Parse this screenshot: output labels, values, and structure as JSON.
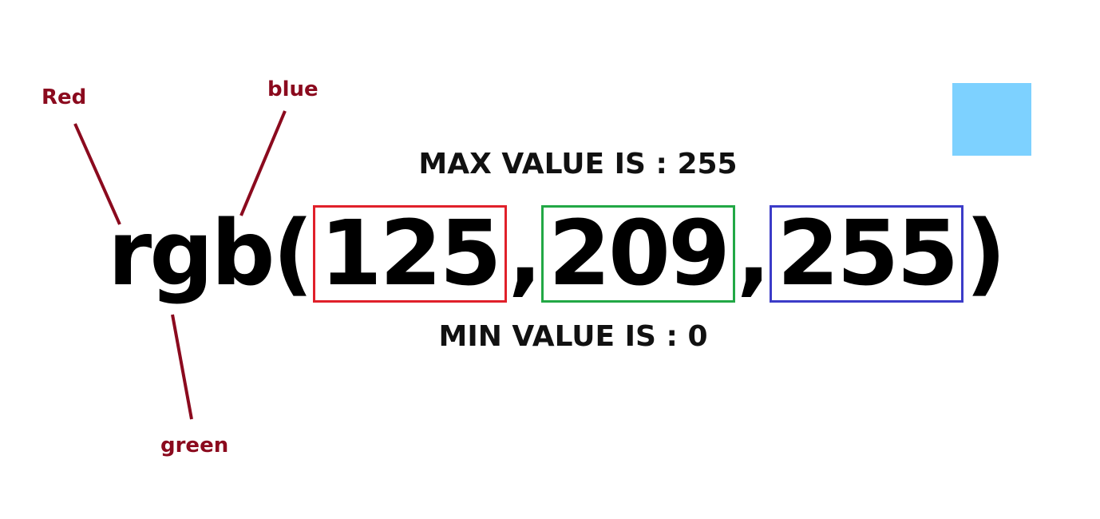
{
  "labels": {
    "red": "Red",
    "blue": "blue",
    "green": "green"
  },
  "captions": {
    "max": "MAX VALUE IS : 255",
    "min": "MIN VALUE IS : 0"
  },
  "expression": {
    "function_name": "rgb",
    "open_paren": "(",
    "close_paren": ")",
    "separator": ",",
    "red_value": "125",
    "green_value": "209",
    "blue_value": "255"
  },
  "colors": {
    "annotation_text": "#8b0a1e",
    "annotation_line": "#8b0a1e",
    "red_box": "#e0202a",
    "green_box": "#22a845",
    "blue_box": "#3c3cc8",
    "swatch": "#7dd1ff"
  }
}
